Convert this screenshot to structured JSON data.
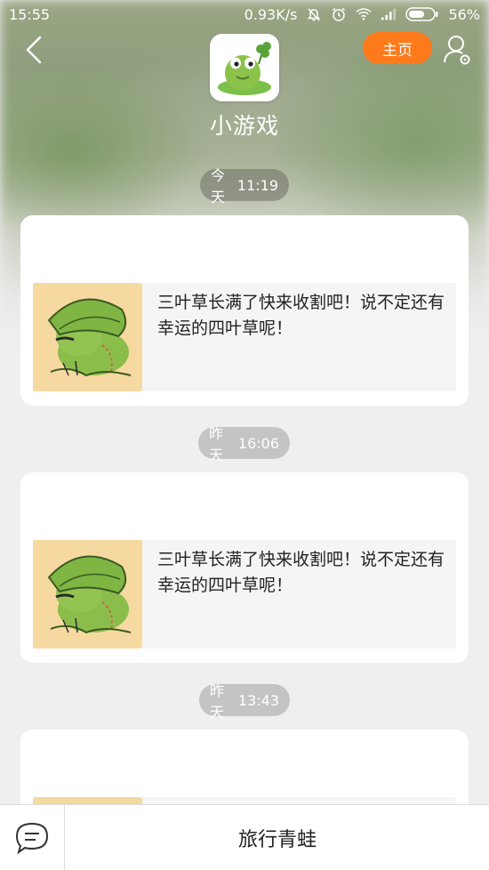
{
  "status_bar": {
    "time": "15:55",
    "network_speed": "0.93K/s",
    "battery": "56%",
    "icons": [
      "mute-bell-icon",
      "alarm-icon",
      "wifi-icon",
      "signal-icon",
      "battery-icon"
    ]
  },
  "header": {
    "back_icon": "chevron-left-icon",
    "home_label": "主页",
    "profile_icon": "user-settings-icon",
    "app_name": "小游戏",
    "accent_color": "#ff7a1a"
  },
  "messages": [
    {
      "time_day": "今天",
      "time_clock": "11:19",
      "text": "三叶草长满了快来收割吧！说不定还有幸运的四叶草呢！"
    },
    {
      "time_day": "昨天",
      "time_clock": "16:06",
      "text": "三叶草长满了快来收割吧！说不定还有幸运的四叶草呢！"
    },
    {
      "time_day": "昨天",
      "time_clock": "13:43",
      "text": ""
    }
  ],
  "bottom_bar": {
    "chat_icon": "chat-bubble-icon",
    "menu_label": "旅行青蛙"
  }
}
